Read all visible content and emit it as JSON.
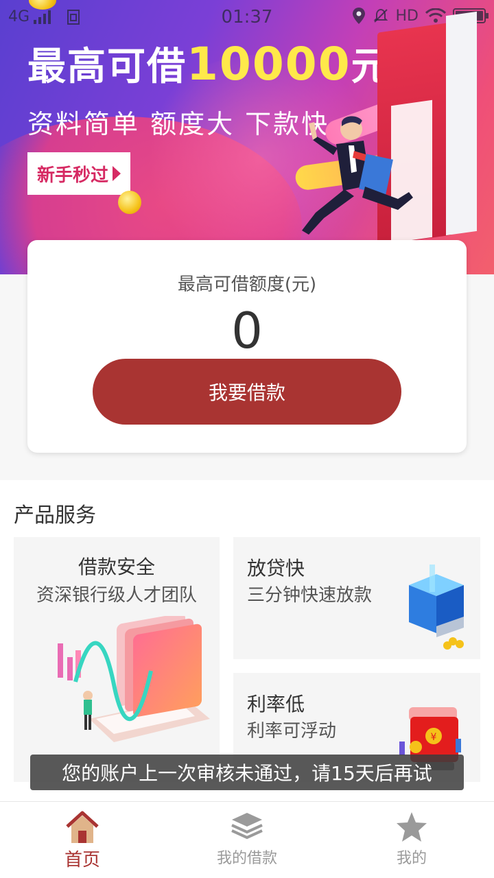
{
  "status_bar": {
    "network": "4G",
    "time": "01:37",
    "hd": "HD"
  },
  "banner": {
    "headline_prefix": "最高可借",
    "headline_amount": "10000",
    "headline_suffix": "元",
    "subline": "资料简单 额度大 下款快",
    "badge_button": "新手秒过",
    "colors": {
      "amount": "#ffe94a",
      "badge_text": "#d62a63"
    }
  },
  "limit_card": {
    "label": "最高可借额度(元)",
    "value": "0",
    "button": "我要借款",
    "button_color": "#a93432"
  },
  "products": {
    "title": "产品服务",
    "items": [
      {
        "title": "借款安全",
        "subtitle": "资深银行级人才团队",
        "icon": "laptop-chart-illustration"
      },
      {
        "title": "放贷快",
        "subtitle": "三分钟快速放款",
        "icon": "coin-machine-illustration"
      },
      {
        "title": "利率低",
        "subtitle": "利率可浮动",
        "icon": "red-envelope-illustration"
      }
    ]
  },
  "toast": "您的账户上一次审核未通过，请15天后再试",
  "tab_bar": {
    "items": [
      {
        "label": "首页",
        "icon": "home-icon",
        "active": true
      },
      {
        "label": "我的借款",
        "icon": "layers-icon",
        "active": false
      },
      {
        "label": "我的",
        "icon": "star-icon",
        "active": false
      }
    ],
    "active_color": "#a93432"
  }
}
